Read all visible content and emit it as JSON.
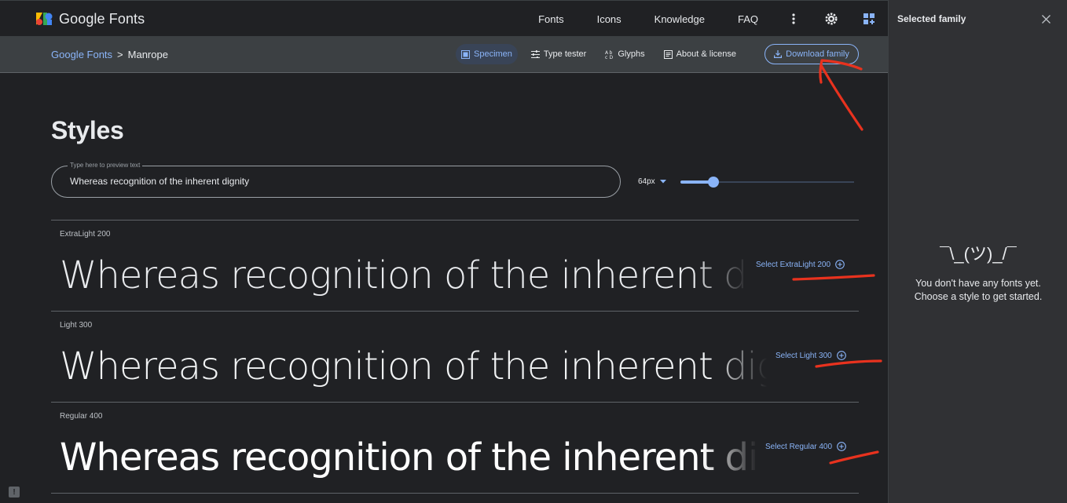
{
  "header": {
    "logo_text": "Google Fonts",
    "nav": [
      "Fonts",
      "Icons",
      "Knowledge",
      "FAQ"
    ],
    "icons": [
      "more-vert-icon",
      "settings-icon",
      "apps-icon"
    ]
  },
  "subnav": {
    "breadcrumb_root": "Google Fonts",
    "breadcrumb_sep": ">",
    "breadcrumb_current": "Manrope",
    "tabs": [
      {
        "label": "Specimen",
        "icon": "specimen-icon",
        "active": true
      },
      {
        "label": "Type tester",
        "icon": "tune-icon",
        "active": false
      },
      {
        "label": "Glyphs",
        "icon": "glyphs-icon",
        "active": false
      },
      {
        "label": "About & license",
        "icon": "article-icon",
        "active": false
      }
    ],
    "download_label": "Download family"
  },
  "styles": {
    "heading": "Styles",
    "preview_legend": "Type here to preview text",
    "preview_value": "Whereas recognition of the inherent dignity",
    "size_label": "64px",
    "size_slider_fraction": 0.19,
    "rows": [
      {
        "label": "ExtraLight 200",
        "sample": "Whereas recognition of the inherent dignity",
        "select_label": "Select ExtraLight 200"
      },
      {
        "label": "Light 300",
        "sample": "Whereas recognition of the inherent dignity",
        "select_label": "Select Light 300"
      },
      {
        "label": "Regular 400",
        "sample": "Whereas recognition of the inherent dignity",
        "select_label": "Select Regular 400"
      }
    ]
  },
  "side_panel": {
    "title": "Selected family",
    "shrug": "¯\\_(ツ)_/¯",
    "empty_line1": "You don't have any fonts yet.",
    "empty_line2": "Choose a style to get started."
  },
  "colors": {
    "background": "#202124",
    "accent": "#8ab4f8",
    "annotation": "#e8321e"
  }
}
